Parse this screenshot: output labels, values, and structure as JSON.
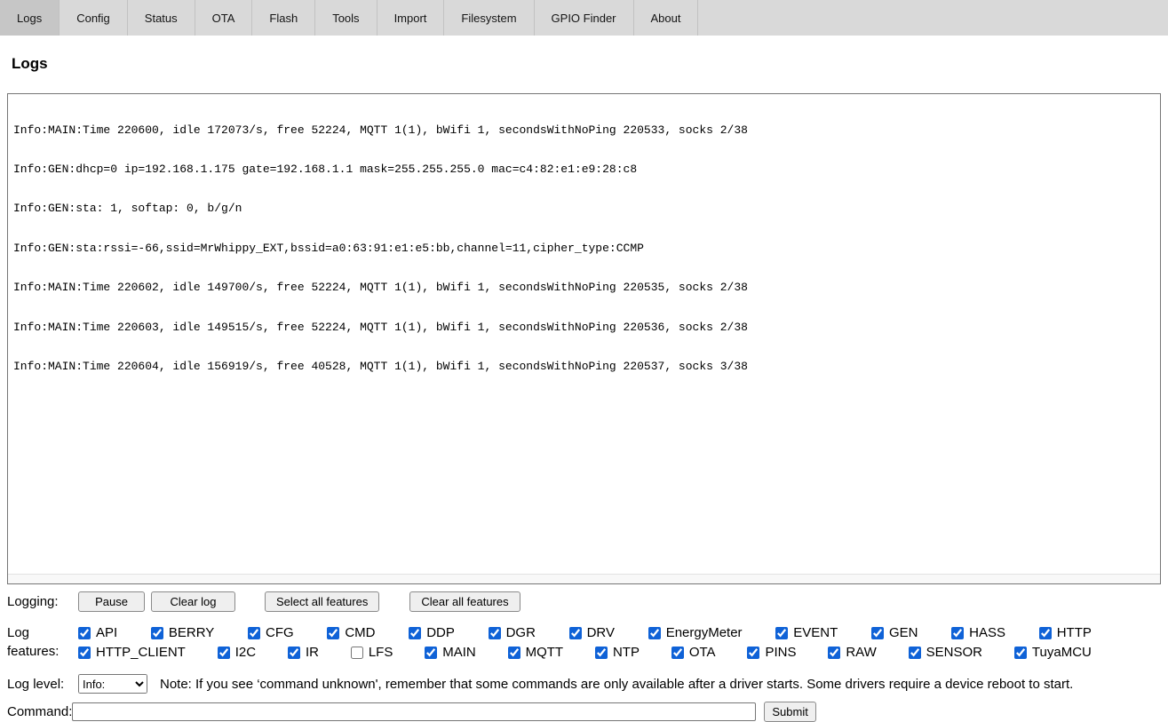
{
  "colors": {
    "accent": "#0f62d7",
    "tabbar_bg": "#d9d9d9",
    "tab_active_bg": "#c6c6c6"
  },
  "tabs": [
    {
      "label": "Logs",
      "active": true
    },
    {
      "label": "Config",
      "active": false
    },
    {
      "label": "Status",
      "active": false
    },
    {
      "label": "OTA",
      "active": false
    },
    {
      "label": "Flash",
      "active": false
    },
    {
      "label": "Tools",
      "active": false
    },
    {
      "label": "Import",
      "active": false
    },
    {
      "label": "Filesystem",
      "active": false
    },
    {
      "label": "GPIO Finder",
      "active": false
    },
    {
      "label": "About",
      "active": false
    }
  ],
  "page": {
    "title": "Logs"
  },
  "log": {
    "lines": [
      "Info:MAIN:Time 220600, idle 172073/s, free 52224, MQTT 1(1), bWifi 1, secondsWithNoPing 220533, socks 2/38",
      "Info:GEN:dhcp=0 ip=192.168.1.175 gate=192.168.1.1 mask=255.255.255.0 mac=c4:82:e1:e9:28:c8",
      "Info:GEN:sta: 1, softap: 0, b/g/n",
      "Info:GEN:sta:rssi=-66,ssid=MrWhippy_EXT,bssid=a0:63:91:e1:e5:bb,channel=11,cipher_type:CCMP",
      "Info:MAIN:Time 220602, idle 149700/s, free 52224, MQTT 1(1), bWifi 1, secondsWithNoPing 220535, socks 2/38",
      "Info:MAIN:Time 220603, idle 149515/s, free 52224, MQTT 1(1), bWifi 1, secondsWithNoPing 220536, socks 2/38",
      "Info:MAIN:Time 220604, idle 156919/s, free 40528, MQTT 1(1), bWifi 1, secondsWithNoPing 220537, socks 3/38"
    ]
  },
  "logging": {
    "label": "Logging:",
    "pause": "Pause",
    "clear_log": "Clear log",
    "select_all": "Select all features",
    "clear_all": "Clear all features"
  },
  "features": {
    "label": "Log features:",
    "row1": [
      {
        "label": "API",
        "checked": true
      },
      {
        "label": "BERRY",
        "checked": true
      },
      {
        "label": "CFG",
        "checked": true
      },
      {
        "label": "CMD",
        "checked": true
      },
      {
        "label": "DDP",
        "checked": true
      },
      {
        "label": "DGR",
        "checked": true
      },
      {
        "label": "DRV",
        "checked": true
      },
      {
        "label": "EnergyMeter",
        "checked": true
      },
      {
        "label": "EVENT",
        "checked": true
      },
      {
        "label": "GEN",
        "checked": true
      },
      {
        "label": "HASS",
        "checked": true
      },
      {
        "label": "HTTP",
        "checked": true
      }
    ],
    "row2": [
      {
        "label": "HTTP_CLIENT",
        "checked": true
      },
      {
        "label": "I2C",
        "checked": true
      },
      {
        "label": "IR",
        "checked": true
      },
      {
        "label": "LFS",
        "checked": false
      },
      {
        "label": "MAIN",
        "checked": true
      },
      {
        "label": "MQTT",
        "checked": true
      },
      {
        "label": "NTP",
        "checked": true
      },
      {
        "label": "OTA",
        "checked": true
      },
      {
        "label": "PINS",
        "checked": true
      },
      {
        "label": "RAW",
        "checked": true
      },
      {
        "label": "SENSOR",
        "checked": true
      },
      {
        "label": "TuyaMCU",
        "checked": true
      }
    ]
  },
  "log_level": {
    "label": "Log level:",
    "selected": "Info:",
    "note": "Note: If you see ‘command unknown', remember that some commands are only available after a driver starts. Some drivers require a device reboot to start."
  },
  "command": {
    "label": "Command:",
    "value": "",
    "submit": "Submit"
  }
}
